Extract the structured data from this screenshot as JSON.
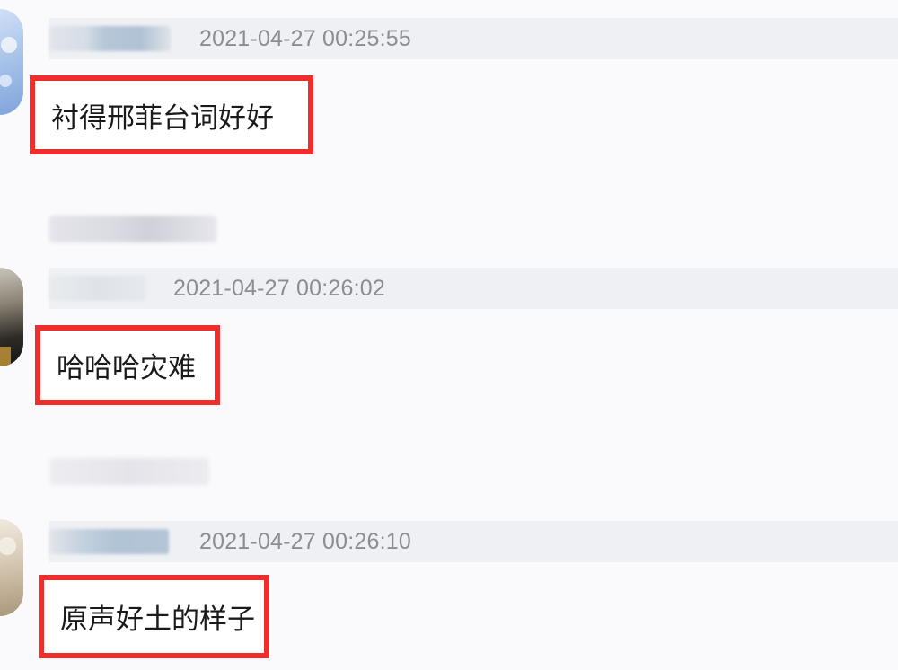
{
  "comments": [
    {
      "timestamp": "2021-04-27 00:25:55",
      "text": "衬得邢菲台词好好"
    },
    {
      "timestamp": "2021-04-27 00:26:02",
      "text": "哈哈哈灾难"
    },
    {
      "timestamp": "2021-04-27 00:26:10",
      "text": "原声好土的样子"
    }
  ],
  "colors": {
    "highlight_border": "#ee2d2d",
    "meta_bar": "#eff0f3",
    "timestamp_text": "#8a8d94",
    "background": "#fafafc"
  }
}
